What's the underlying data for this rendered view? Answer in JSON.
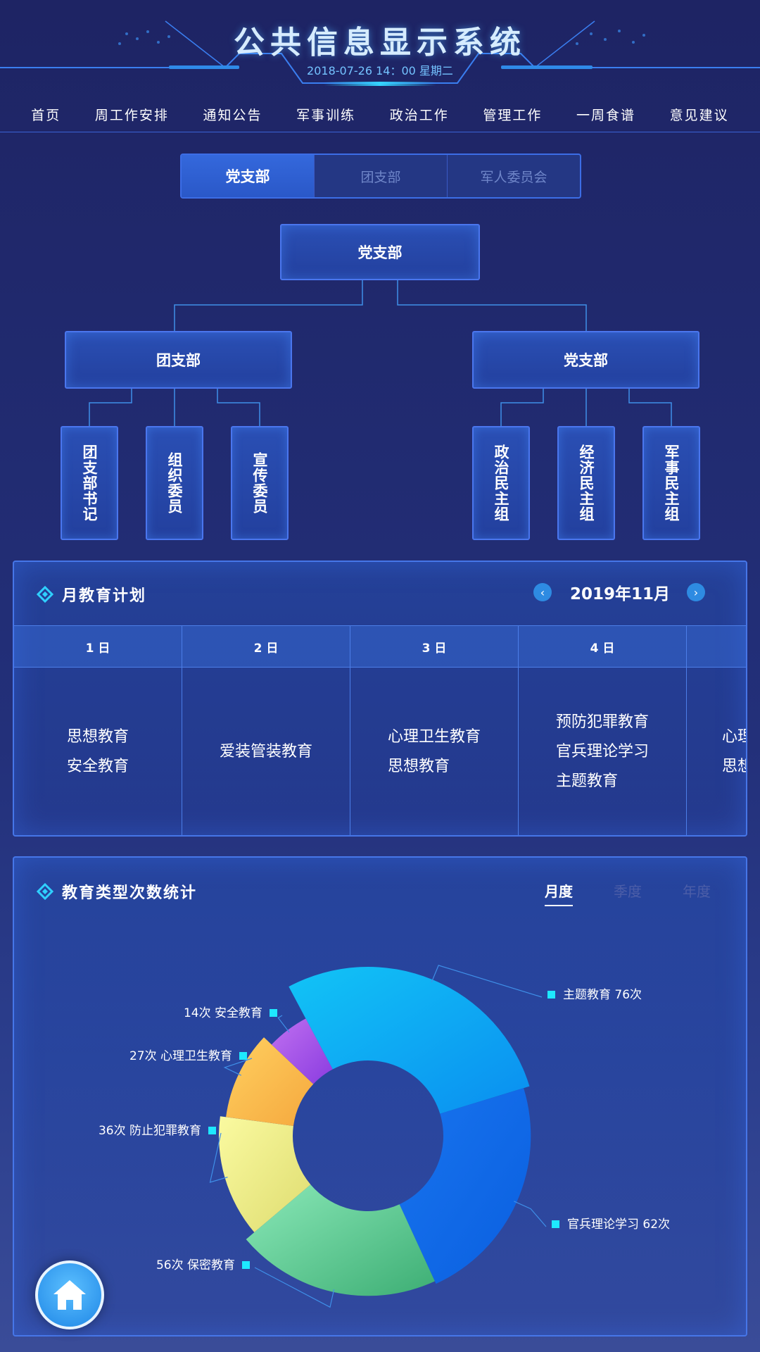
{
  "header": {
    "title": "公共信息显示系统",
    "datetime": "2018-07-26  14：00  星期二"
  },
  "nav": {
    "items": [
      "首页",
      "周工作安排",
      "通知公告",
      "军事训练",
      "政治工作",
      "管理工作",
      "一周食谱",
      "意见建议"
    ]
  },
  "tabs": {
    "items": [
      "党支部",
      "团支部",
      "军人委员会"
    ],
    "active": 0
  },
  "org": {
    "root": "党支部",
    "left": {
      "label": "团支部",
      "children": [
        "团支部书记",
        "组织委员",
        "宣传委员"
      ]
    },
    "right": {
      "label": "党支部",
      "children": [
        "政治民主组",
        "经济民主组",
        "军事民主组"
      ]
    }
  },
  "plan": {
    "title": "月教育计划",
    "month": "2019年11月",
    "prev_icon": "chevron-left-icon",
    "next_icon": "chevron-right-icon",
    "days": [
      {
        "label": "1 日",
        "items": [
          "思想教育",
          "安全教育"
        ]
      },
      {
        "label": "2 日",
        "items": [
          "爱装管装教育"
        ]
      },
      {
        "label": "3 日",
        "items": [
          "心理卫生教育",
          "思想教育"
        ]
      },
      {
        "label": "4 日",
        "items": [
          "预防犯罪教育",
          "官兵理论学习",
          "主题教育"
        ]
      },
      {
        "label": "",
        "items": [
          "心理卫生教育",
          "思想教育"
        ]
      }
    ]
  },
  "stats": {
    "title": "教育类型次数统计",
    "periods": [
      "月度",
      "季度",
      "年度"
    ],
    "active_period": 0
  },
  "chart_data": {
    "type": "pie",
    "variant": "rose-donut",
    "unit": "次",
    "slices": [
      {
        "name": "主题教育",
        "value": 76,
        "color": "#12c4f6",
        "color2": "#0a8ef0",
        "label": "主题教育  76次"
      },
      {
        "name": "官兵理论学习",
        "value": 62,
        "color": "#1874ee",
        "color2": "#0a5fe0",
        "label": "官兵理论学习  62次"
      },
      {
        "name": "保密教育",
        "value": 56,
        "color": "#8ae8b8",
        "color2": "#3dae74",
        "label": "56次  保密教育"
      },
      {
        "name": "防止犯罪教育",
        "value": 36,
        "color": "#fafaa0",
        "color2": "#dedc70",
        "label": "36次  防止犯罪教育"
      },
      {
        "name": "心理卫生教育",
        "value": 27,
        "color": "#ffd060",
        "color2": "#f5a83e",
        "label": "27次  心理卫生教育"
      },
      {
        "name": "安全教育",
        "value": 14,
        "color": "#c070f0",
        "color2": "#8a3ce0",
        "label": "14次  安全教育"
      }
    ]
  },
  "colors": {
    "accent": "#4676e8",
    "legend_marker": "#1ee8ff",
    "bg_top": "#1e2464"
  },
  "home_button_icon": "home-icon"
}
